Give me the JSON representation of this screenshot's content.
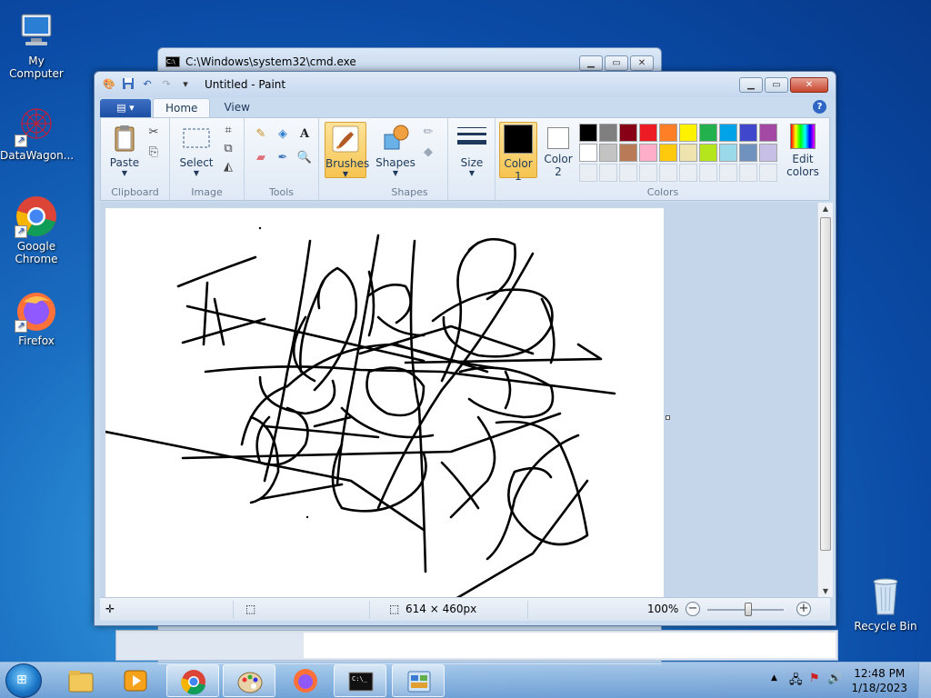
{
  "desktop": {
    "icons": [
      {
        "label": "My Computer",
        "icon": "computer-icon"
      },
      {
        "label": "DataWagon...",
        "icon": "datawagon-icon"
      },
      {
        "label": "Google Chrome",
        "icon": "chrome-icon"
      },
      {
        "label": "Firefox",
        "icon": "firefox-icon"
      },
      {
        "label": "Recycle Bin",
        "icon": "recycle-bin-icon"
      }
    ]
  },
  "cmd_window": {
    "title": "C:\\Windows\\system32\\cmd.exe"
  },
  "paint": {
    "title": "Untitled - Paint",
    "tabs": [
      {
        "label": "Home",
        "active": true
      },
      {
        "label": "View",
        "active": false
      }
    ],
    "ribbon": {
      "clipboard": {
        "paste": "Paste",
        "group": "Clipboard"
      },
      "image": {
        "select": "Select",
        "group": "Image"
      },
      "tools": {
        "group": "Tools"
      },
      "brushes": "Brushes",
      "shapes": {
        "shapes": "Shapes",
        "group": "Shapes"
      },
      "size": "Size",
      "colors": {
        "color1_line1": "Color",
        "color1_line2": "1",
        "color2_line1": "Color",
        "color2_line2": "2",
        "edit_line1": "Edit",
        "edit_line2": "colors",
        "group": "Colors",
        "color1": "#000000",
        "color2": "#ffffff",
        "row1": [
          "#000000",
          "#7f7f7f",
          "#880015",
          "#ed1c24",
          "#ff7f27",
          "#fff200",
          "#22b14c",
          "#00a2e8",
          "#3f48cc",
          "#a349a4"
        ],
        "row2": [
          "#ffffff",
          "#c3c3c3",
          "#b97a57",
          "#ffaec9",
          "#ffc90e",
          "#efe4b0",
          "#b5e61d",
          "#99d9ea",
          "#7092be",
          "#c8bfe7"
        ]
      }
    },
    "status": {
      "size": "614 × 460px",
      "zoom": "100%"
    }
  },
  "taskbar": {
    "items": [
      "explorer-icon",
      "media-player-icon",
      "chrome-icon",
      "paint-icon",
      "firefox-icon",
      "cmd-icon",
      "control-panel-icon"
    ],
    "time": "12:48 PM",
    "date": "1/18/2023"
  }
}
